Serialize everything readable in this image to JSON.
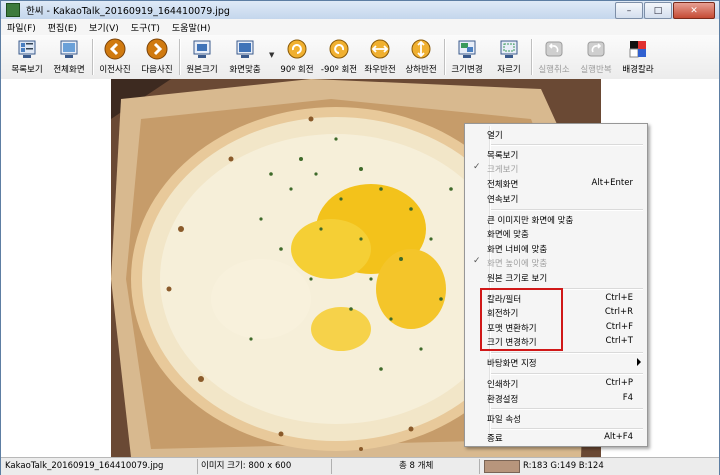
{
  "window": {
    "title": "한씨 - KakaoTalk_20160919_164410079.jpg",
    "controls": [
      "–",
      "□",
      "✕"
    ]
  },
  "menubar": [
    "파일(F)",
    "편집(E)",
    "보기(V)",
    "도구(T)",
    "도움말(H)"
  ],
  "toolbar": [
    {
      "label": "목록보기",
      "icon": "list-view-icon",
      "enabled": true
    },
    {
      "label": "전체화면",
      "icon": "fullscreen-icon",
      "enabled": true
    },
    {
      "label": "이전사진",
      "icon": "prev-arrow-icon",
      "enabled": true
    },
    {
      "label": "다음사진",
      "icon": "next-arrow-icon",
      "enabled": true
    },
    {
      "label": "원본크기",
      "icon": "original-size-icon",
      "enabled": true
    },
    {
      "label": "화면맞춤",
      "icon": "fit-screen-icon",
      "enabled": true
    },
    {
      "label": "90º 회전",
      "icon": "rotate-cw-icon",
      "enabled": true
    },
    {
      "label": "-90º 회전",
      "icon": "rotate-ccw-icon",
      "enabled": true
    },
    {
      "label": "좌우반전",
      "icon": "flip-horizontal-icon",
      "enabled": true
    },
    {
      "label": "상하반전",
      "icon": "flip-vertical-icon",
      "enabled": true
    },
    {
      "label": "크기변경",
      "icon": "resize-icon",
      "enabled": true
    },
    {
      "label": "자르기",
      "icon": "crop-icon",
      "enabled": true
    },
    {
      "label": "실행취소",
      "icon": "undo-icon",
      "enabled": false
    },
    {
      "label": "실행반복",
      "icon": "redo-icon",
      "enabled": false
    },
    {
      "label": "배경칼라",
      "icon": "background-color-icon",
      "enabled": true
    }
  ],
  "context_menu": [
    {
      "label": "열기",
      "shortcut": "",
      "enabled": true,
      "checked": false
    },
    {
      "separator": true
    },
    {
      "label": "목록보기",
      "shortcut": "",
      "enabled": true,
      "checked": false
    },
    {
      "label": "크게보기",
      "shortcut": "",
      "enabled": false,
      "checked": true
    },
    {
      "label": "전체화면",
      "shortcut": "Alt+Enter",
      "enabled": true,
      "checked": false
    },
    {
      "label": "연속보기",
      "shortcut": "",
      "enabled": true,
      "checked": false
    },
    {
      "separator": true
    },
    {
      "label": "큰 이미지만 화면에 맞춤",
      "shortcut": "",
      "enabled": true,
      "checked": false
    },
    {
      "label": "화면에 맞춤",
      "shortcut": "",
      "enabled": true,
      "checked": false
    },
    {
      "label": "화면 너비에 맞춤",
      "shortcut": "",
      "enabled": true,
      "checked": false
    },
    {
      "label": "화면 높이에 맞춤",
      "shortcut": "",
      "enabled": false,
      "checked": true
    },
    {
      "label": "원본 크기로 보기",
      "shortcut": "",
      "enabled": true,
      "checked": false
    },
    {
      "separator": true
    },
    {
      "label": "칼라/필터",
      "shortcut": "Ctrl+E",
      "enabled": true,
      "checked": false
    },
    {
      "label": "회전하기",
      "shortcut": "Ctrl+R",
      "enabled": true,
      "checked": false
    },
    {
      "label": "포맷 변환하기",
      "shortcut": "Ctrl+F",
      "enabled": true,
      "checked": false
    },
    {
      "label": "크기 변경하기",
      "shortcut": "Ctrl+T",
      "enabled": true,
      "checked": false
    },
    {
      "separator": true
    },
    {
      "label": "바탕화면 지정",
      "shortcut": "",
      "enabled": true,
      "checked": false,
      "submenu": true
    },
    {
      "separator": true
    },
    {
      "label": "인쇄하기",
      "shortcut": "Ctrl+P",
      "enabled": true,
      "checked": false
    },
    {
      "label": "환경설정",
      "shortcut": "F4",
      "enabled": true,
      "checked": false
    },
    {
      "separator": true
    },
    {
      "label": "파일 속성",
      "shortcut": "",
      "enabled": true,
      "checked": false
    },
    {
      "separator": true
    },
    {
      "label": "종료",
      "shortcut": "Alt+F4",
      "enabled": true,
      "checked": false
    }
  ],
  "status": {
    "filename": "KakaoTalk_20160919_164410079.jpg",
    "image_size": "이미지 크기: 800 x 600",
    "count": "총 8 개체",
    "color_value": "R:183 G:149 B:124",
    "swatch_color": "#b7957c"
  },
  "colors": {
    "highlight_box": "#d01818",
    "title_gradient": "#c4d6ec"
  }
}
